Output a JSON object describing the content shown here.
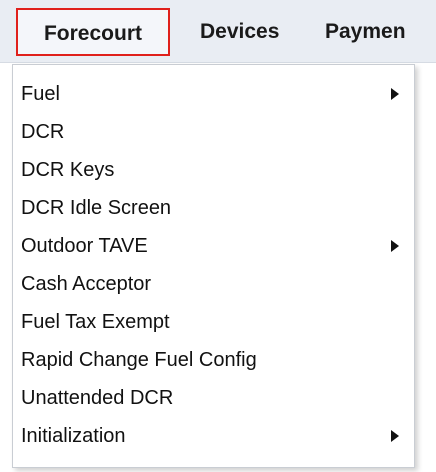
{
  "menubar": {
    "tabs": [
      {
        "label": "Forecourt",
        "active": true
      },
      {
        "label": "Devices"
      },
      {
        "label": "Paymen"
      }
    ],
    "active_outline_color": "#e0201b"
  },
  "dropdown": {
    "items": [
      {
        "label": "Fuel",
        "submenu": true
      },
      {
        "label": "DCR",
        "submenu": false
      },
      {
        "label": "DCR Keys",
        "submenu": false
      },
      {
        "label": "DCR Idle Screen",
        "submenu": false
      },
      {
        "label": "Outdoor TAVE",
        "submenu": true
      },
      {
        "label": "Cash Acceptor",
        "submenu": false
      },
      {
        "label": "Fuel Tax Exempt",
        "submenu": false
      },
      {
        "label": "Rapid Change Fuel Config",
        "submenu": false
      },
      {
        "label": "Unattended DCR",
        "submenu": false
      },
      {
        "label": "Initialization",
        "submenu": true
      }
    ],
    "submenu_icon": "triangle-right-icon"
  }
}
